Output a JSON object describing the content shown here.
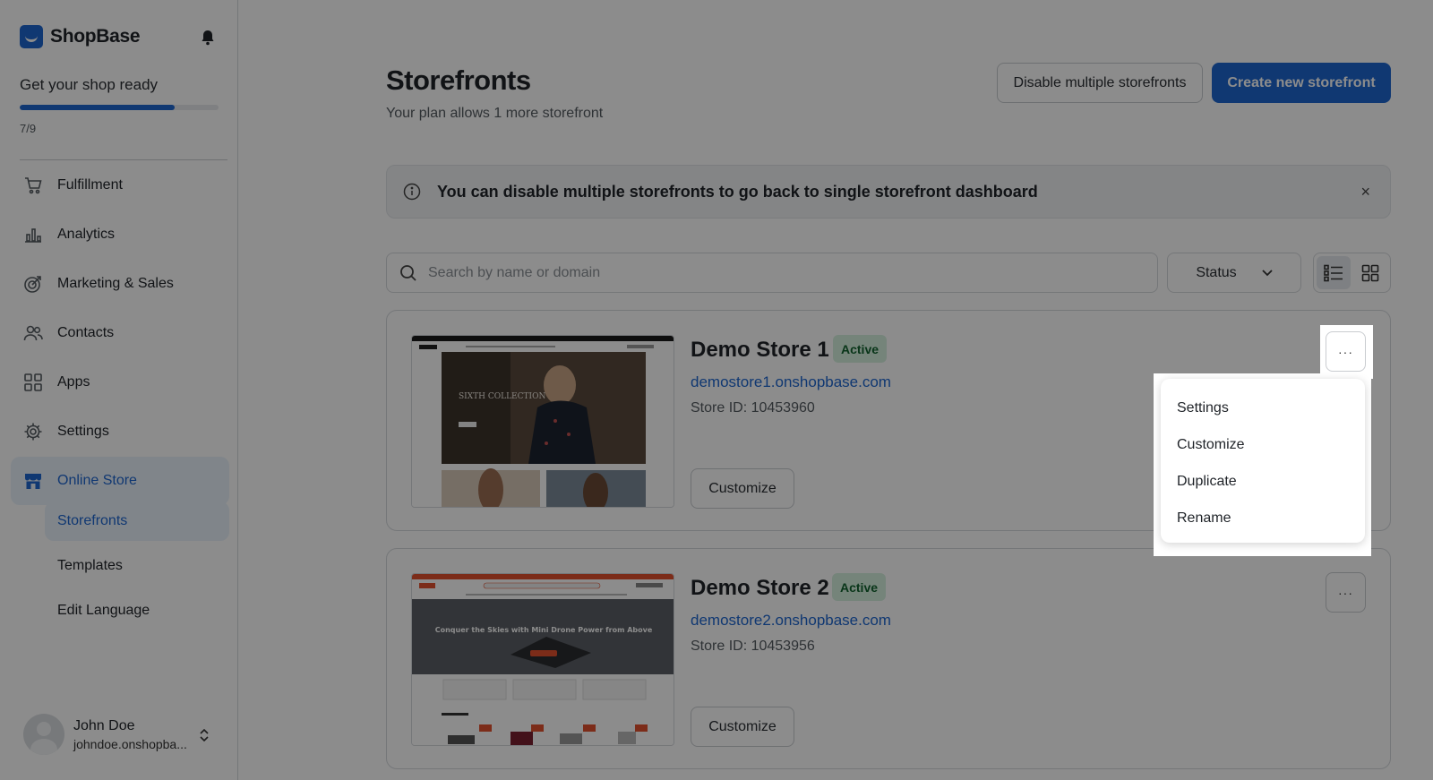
{
  "brand": {
    "name": "ShopBase"
  },
  "onboarding": {
    "title": "Get your shop ready",
    "progress_text": "7/9",
    "progress_fraction": 0.778
  },
  "sidebar": {
    "items": [
      {
        "label": "Fulfillment",
        "icon": "cart-icon"
      },
      {
        "label": "Analytics",
        "icon": "bar-chart-icon"
      },
      {
        "label": "Marketing & Sales",
        "icon": "target-icon"
      },
      {
        "label": "Contacts",
        "icon": "users-icon"
      },
      {
        "label": "Apps",
        "icon": "apps-grid-icon"
      },
      {
        "label": "Settings",
        "icon": "gear-icon"
      },
      {
        "label": "Online Store",
        "icon": "store-icon"
      }
    ],
    "subitems": [
      {
        "label": "Storefronts"
      },
      {
        "label": "Templates"
      },
      {
        "label": "Edit Language"
      }
    ]
  },
  "user": {
    "name": "John Doe",
    "email": "johndoe.onshopba..."
  },
  "header": {
    "title": "Storefronts",
    "subtitle": "Your plan allows 1 more storefront",
    "disable_button": "Disable multiple storefronts",
    "create_button": "Create new storefront"
  },
  "banner": {
    "text": "You can disable multiple storefronts to go back to single storefront dashboard",
    "close": "×"
  },
  "filters": {
    "search_placeholder": "Search by name or domain",
    "status_label": "Status"
  },
  "stores": [
    {
      "name": "Demo Store 1",
      "status": "Active",
      "url": "demostore1.onshopbase.com",
      "store_id": "Store ID: 10453960",
      "customize": "Customize",
      "thumb_caption": "SIXTH COLLECTION"
    },
    {
      "name": "Demo Store 2",
      "status": "Active",
      "url": "demostore2.onshopbase.com",
      "store_id": "Store ID: 10453956",
      "customize": "Customize",
      "thumb_caption": "Conquer the Skies with Mini Drone Power from Above"
    }
  ],
  "more_label": "···",
  "menu": {
    "items": [
      "Settings",
      "Customize",
      "Duplicate",
      "Rename"
    ]
  },
  "colors": {
    "accent": "#1e66d0",
    "active_badge_bg": "#d6f0de",
    "active_badge_text": "#11632f"
  }
}
